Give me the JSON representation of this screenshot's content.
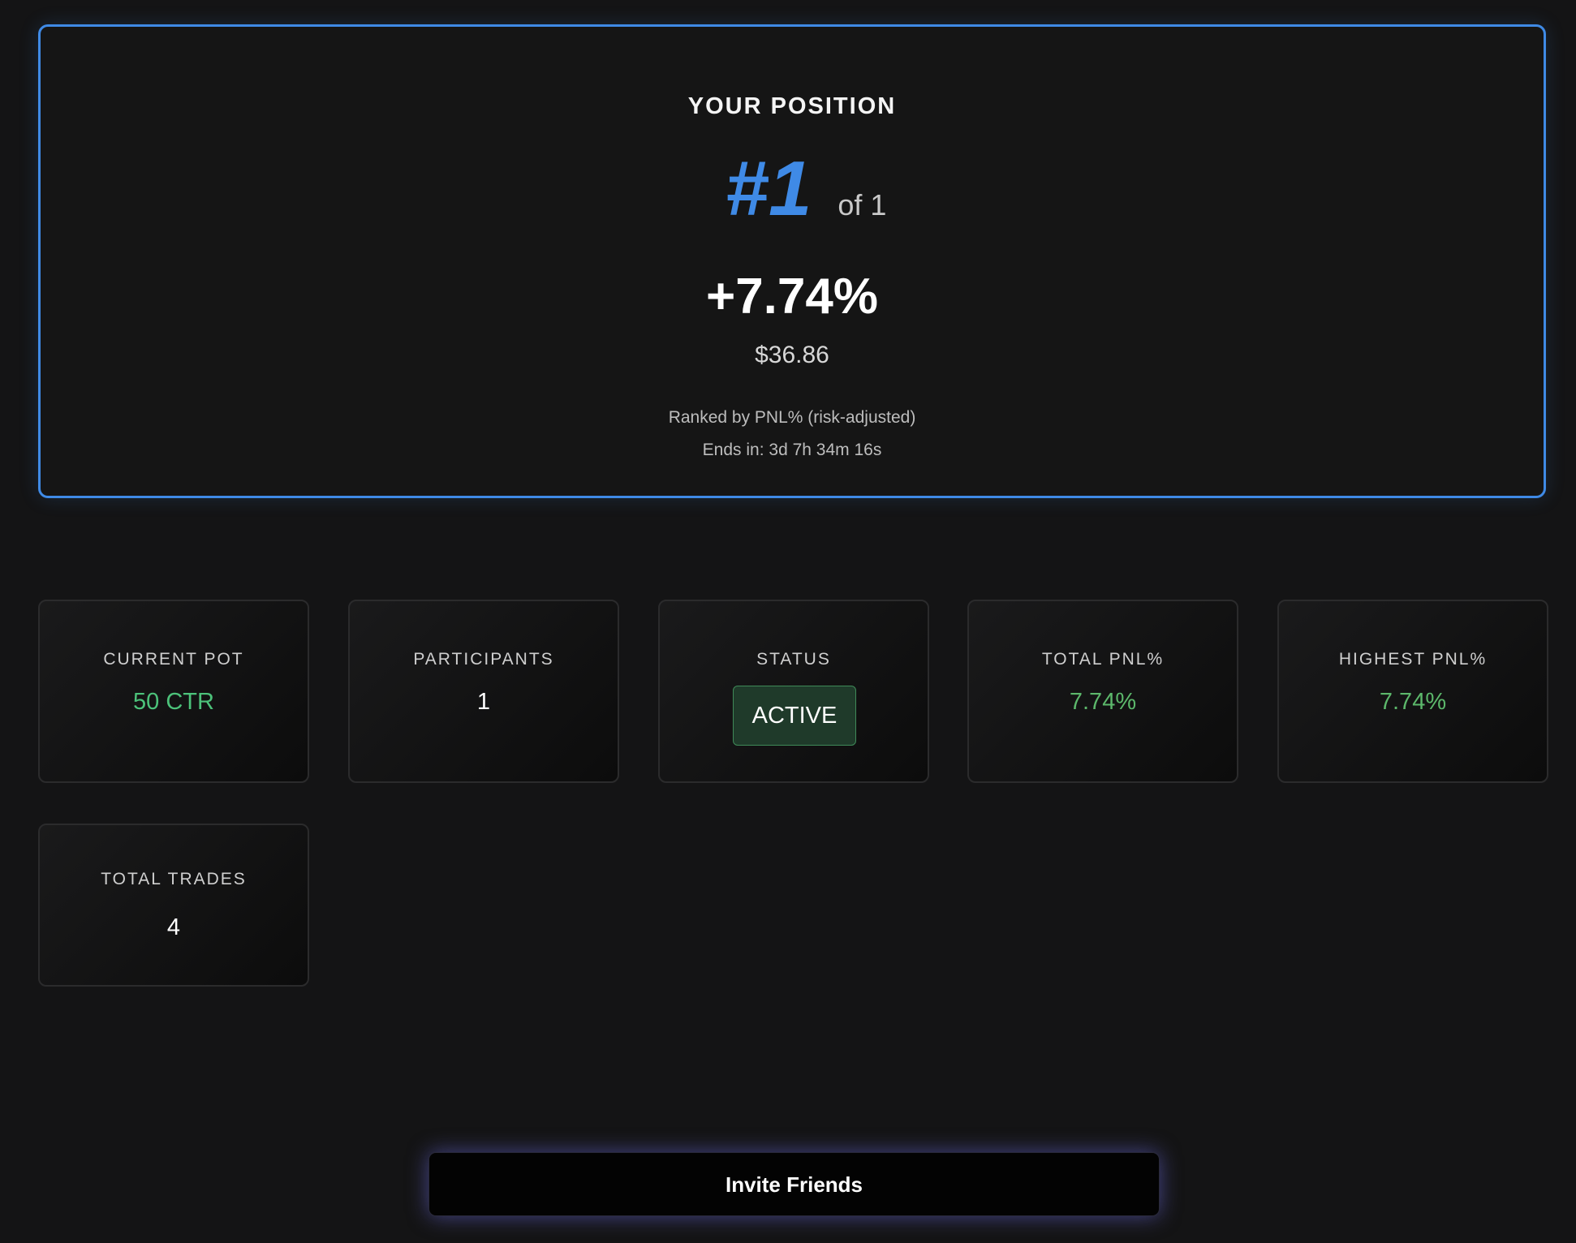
{
  "position": {
    "title": "YOUR POSITION",
    "rank": "#1",
    "rank_total": "of 1",
    "pnl_percent": "+7.74%",
    "pnl_value": "$36.86",
    "ranked_note": "Ranked by PNL% (risk-adjusted)",
    "ends_in": "Ends in: 3d 7h 34m 16s"
  },
  "stats": {
    "current_pot": {
      "label": "CURRENT POT",
      "value": "50 CTR"
    },
    "participants": {
      "label": "PARTICIPANTS",
      "value": "1"
    },
    "status": {
      "label": "STATUS",
      "value": "ACTIVE"
    },
    "total_pnl": {
      "label": "TOTAL PNL%",
      "value": "7.74%"
    },
    "highest_pnl": {
      "label": "HIGHEST PNL%",
      "value": "7.74%"
    },
    "total_trades": {
      "label": "TOTAL TRADES",
      "value": "4"
    }
  },
  "actions": {
    "invite_label": "Invite Friends"
  },
  "colors": {
    "accent_blue": "#3f8ae6",
    "positive_green": "#4cc27a",
    "active_badge_bg": "#1f3a2a",
    "background": "#141415"
  }
}
